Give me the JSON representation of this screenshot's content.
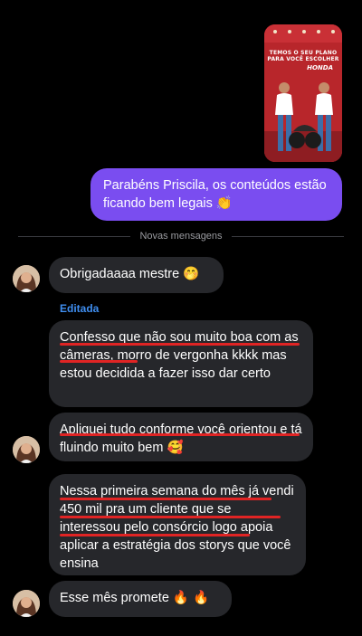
{
  "story": {
    "overlay_text": "TEMOS O SEU PLANO PARA VOCÊ ESCOLHER",
    "brand": "HONDA"
  },
  "sent_message": {
    "text": "Parabéns Priscila, os conteúdos estão ficando bem legais 👏"
  },
  "divider": {
    "label": "Novas mensagens"
  },
  "messages": [
    {
      "text": "Obrigadaaaa mestre 🤭"
    },
    {
      "text": "Confesso que não sou muito boa com as câmeras, morro de vergonha kkkk mas estou decidida a fazer isso dar certo"
    },
    {
      "text": "Apliquei tudo conforme você orientou e tá fluindo muito bem 🥰"
    },
    {
      "text": "Nessa primeira semana do mês já vendi 450 mil pra um cliente que se interessou pelo consórcio logo apoia aplicar a estratégia dos storys que você ensina"
    },
    {
      "text": "Esse mês promete 🔥 🔥"
    }
  ],
  "edited_label": "Editada",
  "colors": {
    "background": "#000000",
    "sent_bubble": "#7a4df0",
    "received_bubble": "#26272b",
    "edited_label": "#3f8ef0",
    "highlight_underline": "#e02424"
  }
}
